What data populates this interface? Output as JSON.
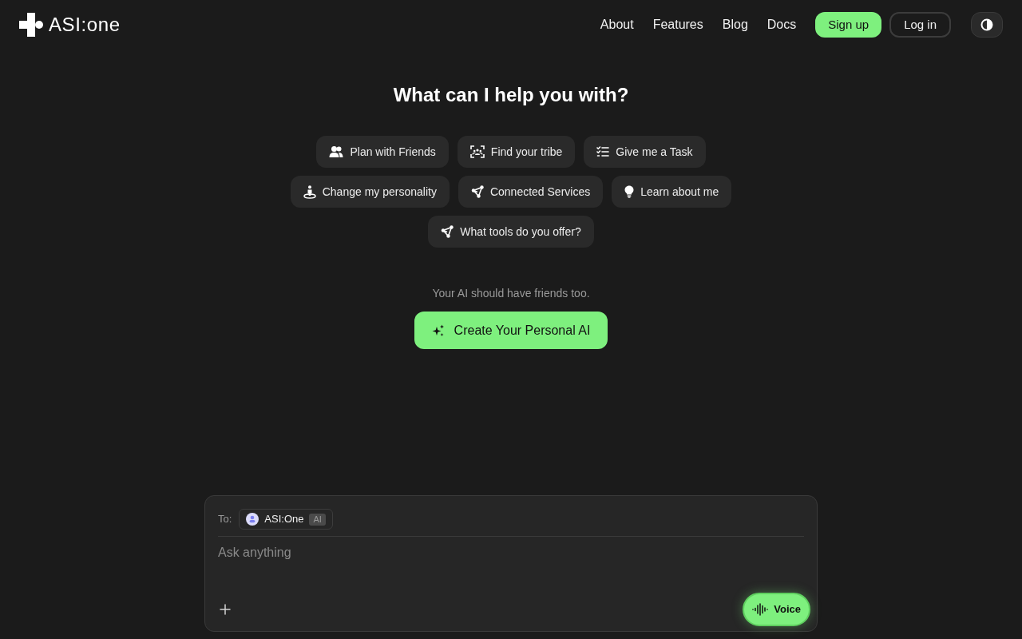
{
  "header": {
    "logo_text": "ASI:one",
    "nav": [
      "About",
      "Features",
      "Blog",
      "Docs"
    ],
    "signup": "Sign up",
    "login": "Log in"
  },
  "heading": "What can I help you with?",
  "suggestion_rows": [
    [
      "Plan with Friends",
      "Find your tribe",
      "Give me a Task"
    ],
    [
      "Change my personality",
      "Connected Services",
      "Learn about me"
    ],
    [
      "What tools do you offer?"
    ]
  ],
  "tagline": "Your AI should have friends too.",
  "create_button": "Create Your Personal AI",
  "composer": {
    "to_label": "To:",
    "recipient": {
      "name": "ASI:One",
      "tag": "AI"
    },
    "placeholder": "Ask anything",
    "voice_button": "Voice"
  }
}
